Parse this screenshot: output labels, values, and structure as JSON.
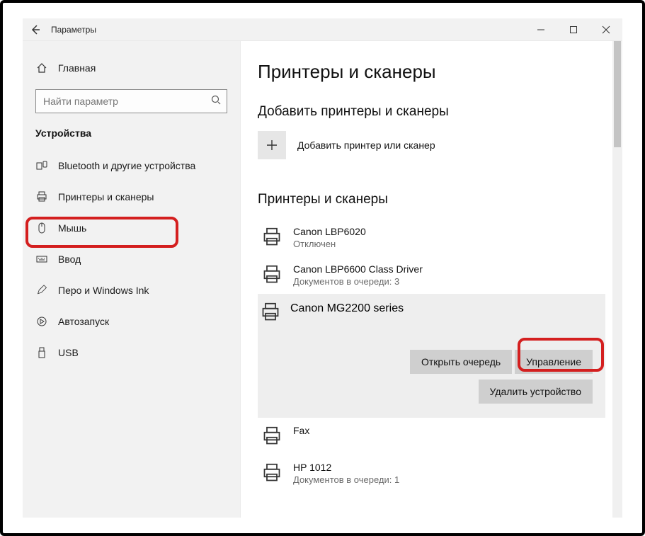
{
  "titlebar": {
    "title": "Параметры"
  },
  "sidebar": {
    "home_label": "Главная",
    "search_placeholder": "Найти параметр",
    "section_title": "Устройства",
    "items": [
      {
        "label": "Bluetooth и другие устройства"
      },
      {
        "label": "Принтеры и сканеры"
      },
      {
        "label": "Мышь"
      },
      {
        "label": "Ввод"
      },
      {
        "label": "Перо и Windows Ink"
      },
      {
        "label": "Автозапуск"
      },
      {
        "label": "USB"
      }
    ]
  },
  "main": {
    "page_title": "Принтеры и сканеры",
    "add_section_title": "Добавить принтеры и сканеры",
    "add_label": "Добавить принтер или сканер",
    "list_title": "Принтеры и сканеры",
    "printers": {
      "p0": {
        "name": "Canon LBP6020",
        "status": "Отключен"
      },
      "p1": {
        "name": "Canon LBP6600 Class Driver",
        "status": "Документов в очереди: 3"
      },
      "p2": {
        "name": "Canon MG2200 series"
      },
      "p3": {
        "name": "Fax"
      },
      "p4": {
        "name": "HP 1012",
        "status": "Документов в очереди: 1"
      }
    },
    "buttons": {
      "open_queue": "Открыть очередь",
      "manage": "Управление",
      "remove": "Удалить устройство"
    }
  }
}
